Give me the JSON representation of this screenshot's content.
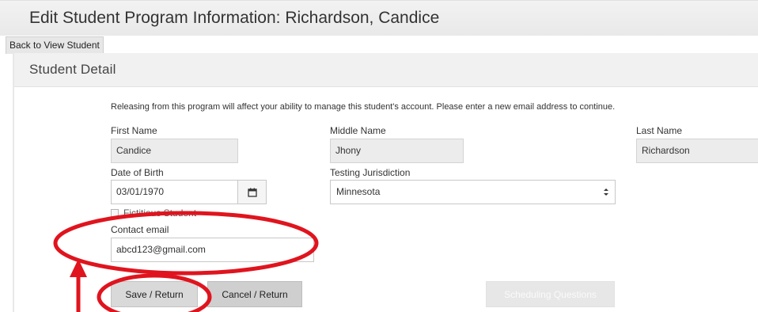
{
  "header": {
    "title": "Edit Student Program Information: Richardson, Candice",
    "back_label": "Back to View Student"
  },
  "section": {
    "title": "Student Detail"
  },
  "notice": "Releasing from this program will affect your ability to manage this student's account. Please enter a new email address to continue.",
  "form": {
    "first_name": {
      "label": "First Name",
      "value": "Candice"
    },
    "middle_name": {
      "label": "Middle Name",
      "value": "Jhony"
    },
    "last_name": {
      "label": "Last Name",
      "value": "Richardson"
    },
    "dob": {
      "label": "Date of Birth",
      "value": "03/01/1970"
    },
    "jurisdiction": {
      "label": "Testing Jurisdiction",
      "value": "Minnesota"
    },
    "fictitious": {
      "label": "Fictitious Student",
      "checked": false
    },
    "email": {
      "label": "Contact email",
      "value": "abcd123@gmail.com"
    }
  },
  "buttons": {
    "save": "Save / Return",
    "cancel": "Cancel / Return",
    "scheduling": "Scheduling Questions"
  },
  "icons": {
    "calendar": "calendar-icon",
    "select_caret": "sort-caret-icon"
  },
  "annotation": {
    "color": "#e0141e",
    "shapes": [
      "ellipse-contact-email",
      "ellipse-save-button",
      "arrow-up"
    ]
  }
}
